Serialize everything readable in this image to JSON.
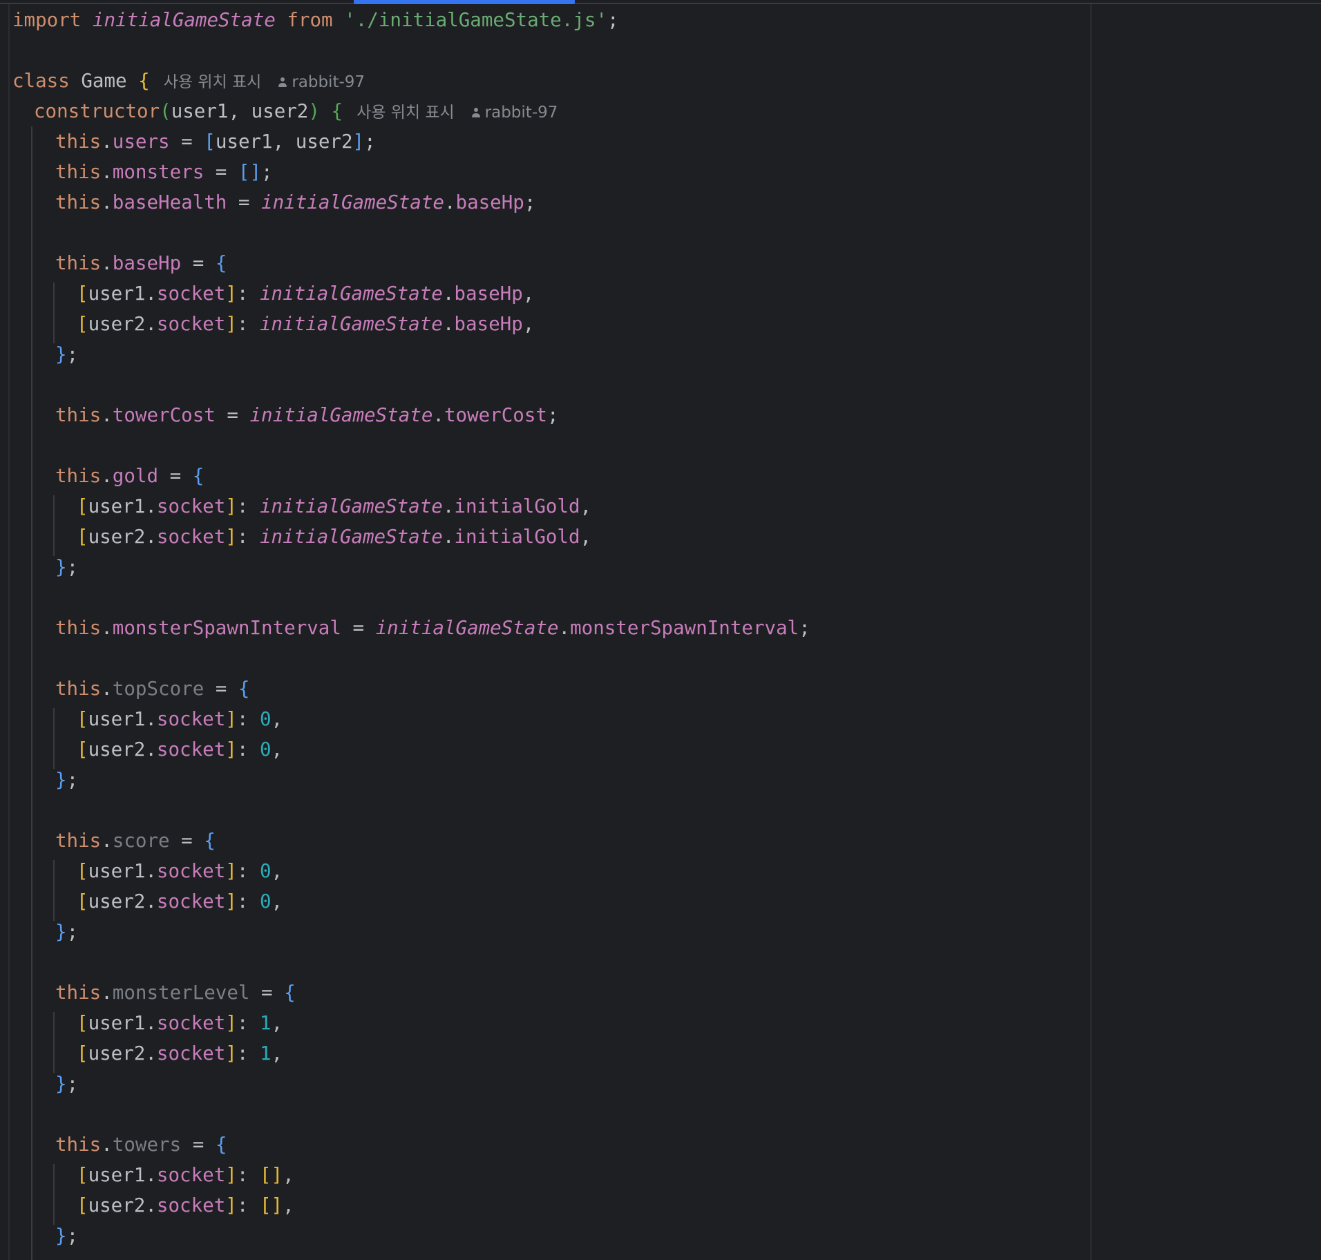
{
  "editor": {
    "file_language": "JavaScript",
    "import_line": {
      "keyword_import": "import",
      "name": "initialGameState",
      "keyword_from": "from",
      "path": "'./initialGameState.js'",
      "semicolon": ";"
    },
    "class_line": {
      "keyword": "class",
      "name": "Game",
      "brace": "{",
      "usages_hint": "사용 위치 표시",
      "author_hint": "rabbit-97"
    },
    "constructor_line": {
      "name": "constructor",
      "params": "user1, user2",
      "brace": "{",
      "usages_hint": "사용 위치 표시",
      "author_hint": "rabbit-97"
    },
    "statements": {
      "users_prop": "users",
      "users_value": "user1, user2",
      "monsters_prop": "monsters",
      "baseHealth_prop": "baseHealth",
      "baseHealth_source": "baseHp",
      "baseHp_prop": "baseHp",
      "baseHp_value": "baseHp",
      "towerCost_prop": "towerCost",
      "towerCost_source": "towerCost",
      "gold_prop": "gold",
      "gold_value": "initialGold",
      "spawn_prop": "monsterSpawnInterval",
      "spawn_source": "monsterSpawnInterval",
      "topScore_prop": "topScore",
      "topScore_value": "0",
      "score_prop": "score",
      "score_value": "0",
      "monsterLevel_prop": "monsterLevel",
      "monsterLevel_value": "1",
      "towers_prop": "towers"
    },
    "tokens": {
      "this": "this",
      "user1": "user1",
      "user2": "user2",
      "socket": "socket",
      "state": "initialGameState"
    },
    "colors": {
      "background": "#1e1f22",
      "keyword": "#cf8e6d",
      "string": "#6aab73",
      "property": "#c77dbb",
      "number": "#2aacb8",
      "hint": "#868a91",
      "scrollbar_accent": "#3574f0"
    },
    "icons": [
      "user-icon"
    ]
  }
}
